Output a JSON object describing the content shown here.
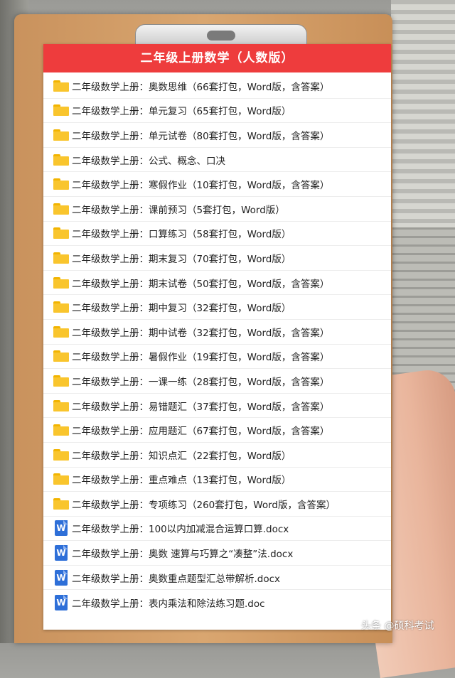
{
  "document": {
    "title": "二年级上册数学（人数版）",
    "items": [
      {
        "type": "folder",
        "label": "二年级数学上册：奥数思维（66套打包，Word版，含答案）",
        "icon": "folder-icon"
      },
      {
        "type": "folder",
        "label": "二年级数学上册：单元复习（65套打包，Word版）",
        "icon": "folder-icon"
      },
      {
        "type": "folder",
        "label": "二年级数学上册：单元试卷（80套打包，Word版，含答案）",
        "icon": "folder-icon"
      },
      {
        "type": "folder",
        "label": "二年级数学上册：公式、概念、口决",
        "icon": "folder-icon"
      },
      {
        "type": "folder",
        "label": "二年级数学上册：寒假作业（10套打包，Word版，含答案）",
        "icon": "folder-icon"
      },
      {
        "type": "folder",
        "label": "二年级数学上册：课前预习（5套打包，Word版）",
        "icon": "folder-icon"
      },
      {
        "type": "folder",
        "label": "二年级数学上册：口算练习（58套打包，Word版）",
        "icon": "folder-icon"
      },
      {
        "type": "folder",
        "label": "二年级数学上册：期末复习（70套打包，Word版）",
        "icon": "folder-icon"
      },
      {
        "type": "folder",
        "label": "二年级数学上册：期末试卷（50套打包，Word版，含答案）",
        "icon": "folder-icon"
      },
      {
        "type": "folder",
        "label": "二年级数学上册：期中复习（32套打包，Word版）",
        "icon": "folder-icon"
      },
      {
        "type": "folder",
        "label": "二年级数学上册：期中试卷（32套打包，Word版，含答案）",
        "icon": "folder-icon"
      },
      {
        "type": "folder",
        "label": "二年级数学上册：暑假作业（19套打包，Word版，含答案）",
        "icon": "folder-icon"
      },
      {
        "type": "folder",
        "label": "二年级数学上册：一课一练（28套打包，Word版，含答案）",
        "icon": "folder-icon"
      },
      {
        "type": "folder",
        "label": "二年级数学上册：易错题汇（37套打包，Word版，含答案）",
        "icon": "folder-icon"
      },
      {
        "type": "folder",
        "label": "二年级数学上册：应用题汇（67套打包，Word版，含答案）",
        "icon": "folder-icon"
      },
      {
        "type": "folder",
        "label": "二年级数学上册：知识点汇（22套打包，Word版）",
        "icon": "folder-icon"
      },
      {
        "type": "folder",
        "label": "二年级数学上册：重点难点（13套打包，Word版）",
        "icon": "folder-icon"
      },
      {
        "type": "folder",
        "label": "二年级数学上册：专项练习（260套打包，Word版，含答案）",
        "icon": "folder-icon"
      },
      {
        "type": "word",
        "label": "二年级数学上册：100以内加减混合运算口算.docx",
        "icon": "word-doc-icon",
        "icon_letter": "W"
      },
      {
        "type": "word",
        "label": "二年级数学上册：奥数 速算与巧算之“凑整”法.docx",
        "icon": "word-doc-icon",
        "icon_letter": "W"
      },
      {
        "type": "word",
        "label": "二年级数学上册：奥数重点题型汇总带解析.docx",
        "icon": "word-doc-icon",
        "icon_letter": "W"
      },
      {
        "type": "word",
        "label": "二年级数学上册：表内乘法和除法练习题.doc",
        "icon": "word-doc-icon",
        "icon_letter": "W"
      }
    ]
  },
  "watermark": "头条 @硕科考试",
  "colors": {
    "header": "#ee3c3d",
    "folder": "#f9c52d",
    "word": "#2e6fd8",
    "board": "#d9a670"
  }
}
